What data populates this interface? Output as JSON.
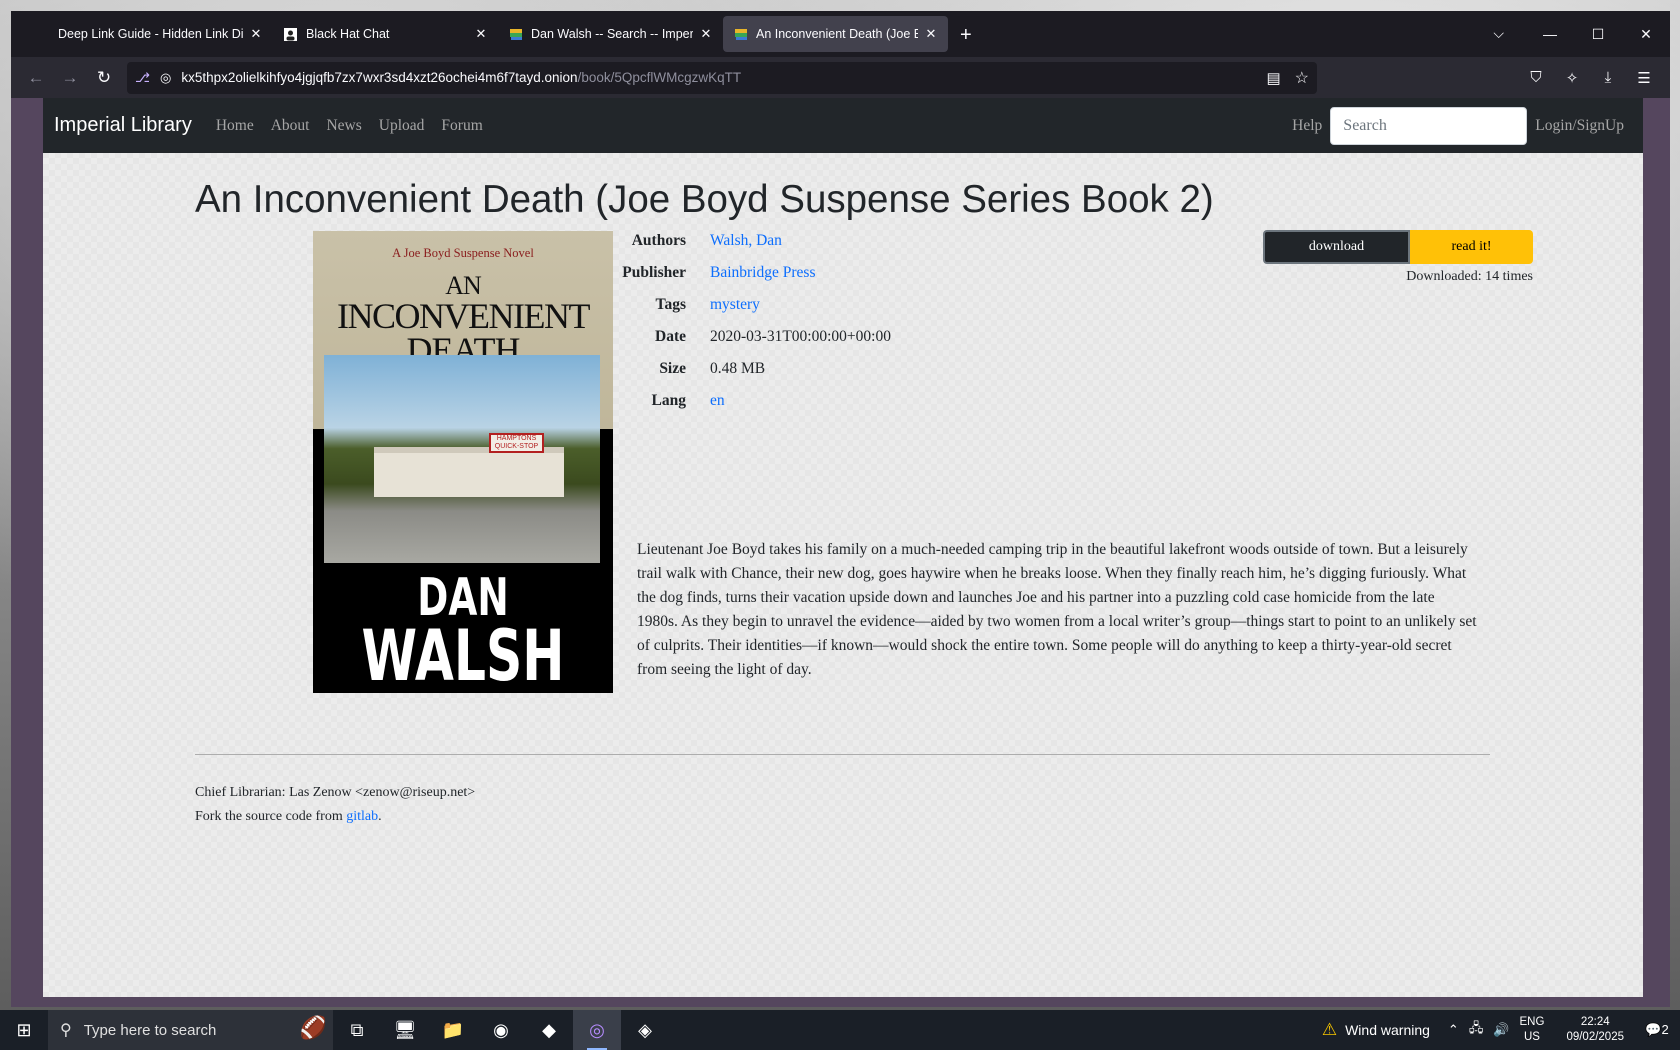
{
  "browser": {
    "tabs": [
      {
        "label": "Deep Link Guide - Hidden Link Direc",
        "icon": "none",
        "active": false
      },
      {
        "label": "Black Hat Chat",
        "icon": "user-icon",
        "active": false
      },
      {
        "label": "Dan Walsh -- Search -- Imperial",
        "icon": "books-icon",
        "active": false
      },
      {
        "label": "An Inconvenient Death (Joe Boy",
        "icon": "books-icon",
        "active": true
      }
    ],
    "url_host": "kx5thpx2olielkihfyo4jgjqfb7zx7wxr3sd4xzt26ochei4m6f7tayd.onion",
    "url_path": "/book/5QpcflWMcgzwKqTT"
  },
  "site": {
    "brand": "Imperial Library",
    "nav": [
      "Home",
      "About",
      "News",
      "Upload",
      "Forum"
    ],
    "help": "Help",
    "search_placeholder": "Search",
    "login": "Login/SignUp"
  },
  "book": {
    "title": "An Inconvenient Death (Joe Boyd Suspense Series Book 2)",
    "cover": {
      "series": "A Joe Boyd Suspense Novel",
      "line1": "AN",
      "line2": "INCONVENIENT",
      "line3": "DEATH",
      "author1": "DAN",
      "author2": "WALSH",
      "sign": "HAMPTONS QUICK-STOP"
    },
    "meta": [
      {
        "key": "Authors",
        "value": "Walsh, Dan",
        "link": true
      },
      {
        "key": "Publisher",
        "value": "Bainbridge Press",
        "link": true
      },
      {
        "key": "Tags",
        "value": "mystery",
        "link": true
      },
      {
        "key": "Date",
        "value": "2020-03-31T00:00:00+00:00",
        "link": false
      },
      {
        "key": "Size",
        "value": "0.48 MB",
        "link": false
      },
      {
        "key": "Lang",
        "value": "en",
        "link": true
      }
    ],
    "download_label": "download",
    "read_label": "read it!",
    "downloaded": "Downloaded: 14 times",
    "description": "Lieutenant Joe Boyd takes his family on a much-needed camping trip in the beautiful lakefront woods outside of town. But a leisurely trail walk with Chance, their new dog, goes haywire when he breaks loose. When they finally reach him, he’s digging furiously. What the dog finds, turns their vacation upside down and launches Joe and his partner into a puzzling cold case homicide from the late 1980s. As they begin to unravel the evidence—aided by two women from a local writer’s group—things start to point to an unlikely set of culprits. Their identities—if known—would shock the entire town. Some people will do anything to keep a thirty-year-old secret from seeing the light of day."
  },
  "footer": {
    "librarian": "Chief Librarian: Las Zenow <zenow@riseup.net>",
    "fork_prefix": "Fork the source code from ",
    "fork_link": "gitlab",
    "fork_suffix": "."
  },
  "taskbar": {
    "search_placeholder": "Type here to search",
    "weather": "Wind warning",
    "lang1": "ENG",
    "lang2": "US",
    "time": "22:24",
    "date": "09/02/2025",
    "notifications": "2"
  },
  "colors": {
    "link": "#0d6efd",
    "read_button": "#ffc107",
    "download_button": "#212529",
    "site_nav": "#22262a"
  }
}
